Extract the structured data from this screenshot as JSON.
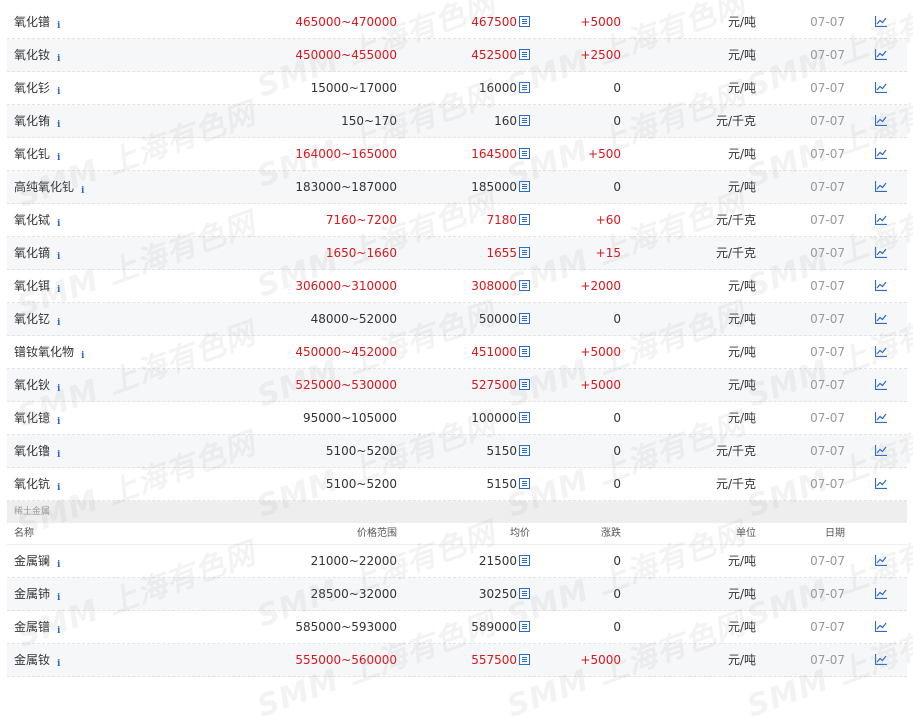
{
  "oxides": [
    {
      "name": "氧化镨",
      "range": "465000~470000",
      "avg": "467500",
      "change": "+5000",
      "unit": "元/吨",
      "date": "07-07"
    },
    {
      "name": "氧化钕",
      "range": "450000~455000",
      "avg": "452500",
      "change": "+2500",
      "unit": "元/吨",
      "date": "07-07"
    },
    {
      "name": "氧化钐",
      "range": "15000~17000",
      "avg": "16000",
      "change": "0",
      "unit": "元/吨",
      "date": "07-07"
    },
    {
      "name": "氧化铕",
      "range": "150~170",
      "avg": "160",
      "change": "0",
      "unit": "元/千克",
      "date": "07-07"
    },
    {
      "name": "氧化钆",
      "range": "164000~165000",
      "avg": "164500",
      "change": "+500",
      "unit": "元/吨",
      "date": "07-07"
    },
    {
      "name": "高纯氧化钆",
      "range": "183000~187000",
      "avg": "185000",
      "change": "0",
      "unit": "元/吨",
      "date": "07-07"
    },
    {
      "name": "氧化铽",
      "range": "7160~7200",
      "avg": "7180",
      "change": "+60",
      "unit": "元/千克",
      "date": "07-07"
    },
    {
      "name": "氧化镝",
      "range": "1650~1660",
      "avg": "1655",
      "change": "+15",
      "unit": "元/千克",
      "date": "07-07"
    },
    {
      "name": "氧化铒",
      "range": "306000~310000",
      "avg": "308000",
      "change": "+2000",
      "unit": "元/吨",
      "date": "07-07"
    },
    {
      "name": "氧化钇",
      "range": "48000~52000",
      "avg": "50000",
      "change": "0",
      "unit": "元/吨",
      "date": "07-07"
    },
    {
      "name": "镨钕氧化物",
      "range": "450000~452000",
      "avg": "451000",
      "change": "+5000",
      "unit": "元/吨",
      "date": "07-07"
    },
    {
      "name": "氧化钬",
      "range": "525000~530000",
      "avg": "527500",
      "change": "+5000",
      "unit": "元/吨",
      "date": "07-07"
    },
    {
      "name": "氧化镱",
      "range": "95000~105000",
      "avg": "100000",
      "change": "0",
      "unit": "元/吨",
      "date": "07-07"
    },
    {
      "name": "氧化镥",
      "range": "5100~5200",
      "avg": "5150",
      "change": "0",
      "unit": "元/千克",
      "date": "07-07"
    },
    {
      "name": "氧化钪",
      "range": "5100~5200",
      "avg": "5150",
      "change": "0",
      "unit": "元/千克",
      "date": "07-07"
    }
  ],
  "metals_section": {
    "title": "稀土金属",
    "headers": {
      "name": "名称",
      "range": "价格范围",
      "avg": "均价",
      "change": "涨跌",
      "unit": "单位",
      "date": "日期"
    },
    "rows": [
      {
        "name": "金属镧",
        "range": "21000~22000",
        "avg": "21500",
        "change": "0",
        "unit": "元/吨",
        "date": "07-07"
      },
      {
        "name": "金属铈",
        "range": "28500~32000",
        "avg": "30250",
        "change": "0",
        "unit": "元/吨",
        "date": "07-07"
      },
      {
        "name": "金属镨",
        "range": "585000~593000",
        "avg": "589000",
        "change": "0",
        "unit": "元/吨",
        "date": "07-07"
      },
      {
        "name": "金属钕",
        "range": "555000~560000",
        "avg": "557500",
        "change": "+5000",
        "unit": "元/吨",
        "date": "07-07"
      }
    ]
  },
  "icons": {
    "info": "info-icon",
    "average": "average-detail-icon",
    "trend": "trend-chart-icon"
  },
  "colors": {
    "rise": "#d8161c",
    "neutral": "#333333",
    "date": "#999999",
    "icon": "#2c6cc8",
    "alt_row": "#f6f7f9"
  },
  "watermark": "SMM 上海有色网"
}
